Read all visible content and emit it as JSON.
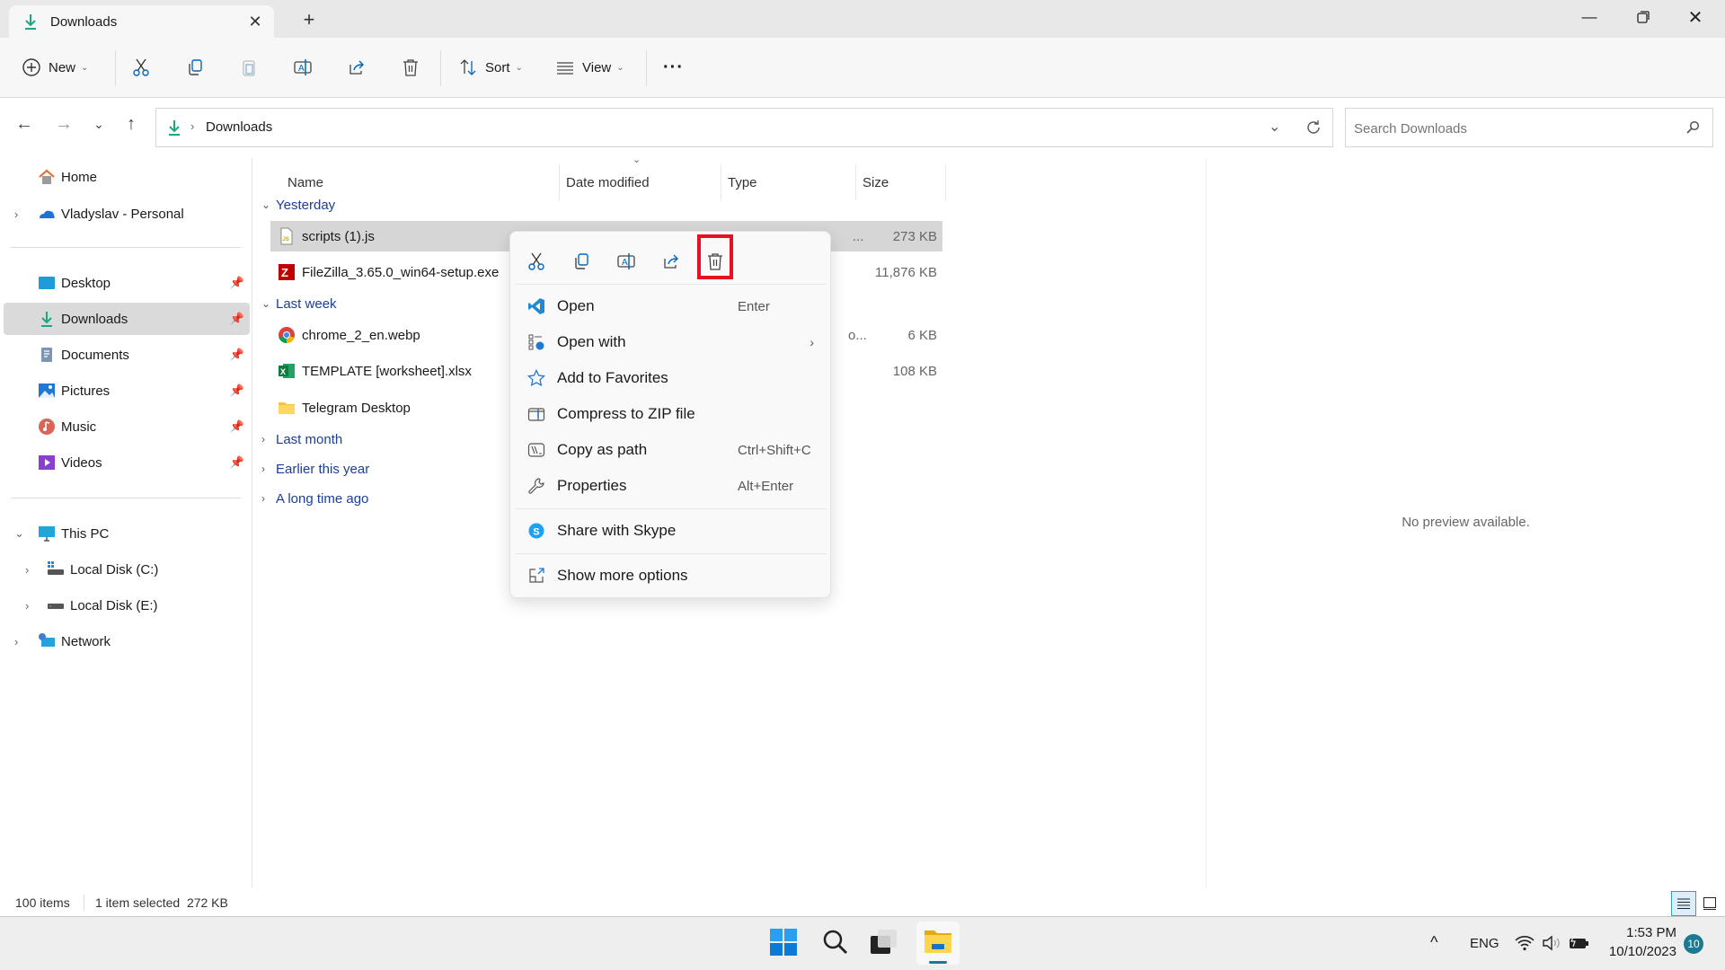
{
  "window": {
    "tab_title": "Downloads",
    "tab_icon": "download-icon",
    "controls": {
      "minimize": "minimize-icon",
      "maximize": "restore-icon",
      "close": "close-icon"
    }
  },
  "toolbar": {
    "new_label": "New",
    "sort_label": "Sort",
    "view_label": "View",
    "buttons": [
      "cut",
      "copy",
      "paste",
      "rename",
      "share",
      "delete"
    ],
    "more": "more-options"
  },
  "address": {
    "path": [
      "Downloads"
    ],
    "search_placeholder": "Search Downloads"
  },
  "sidebar": {
    "top": [
      {
        "label": "Home",
        "icon": "home-icon"
      },
      {
        "label": "Vladyslav - Personal",
        "icon": "onedrive-icon",
        "expandable": true
      }
    ],
    "quick_access": [
      {
        "label": "Desktop",
        "icon": "desktop-icon",
        "pinned": true
      },
      {
        "label": "Downloads",
        "icon": "download-icon",
        "pinned": true,
        "selected": true
      },
      {
        "label": "Documents",
        "icon": "documents-icon",
        "pinned": true
      },
      {
        "label": "Pictures",
        "icon": "pictures-icon",
        "pinned": true
      },
      {
        "label": "Music",
        "icon": "music-icon",
        "pinned": true
      },
      {
        "label": "Videos",
        "icon": "videos-icon",
        "pinned": true
      }
    ],
    "this_pc": {
      "label": "This PC",
      "expanded": true
    },
    "drives": [
      {
        "label": "Local Disk (C:)"
      },
      {
        "label": "Local Disk (E:)"
      }
    ],
    "network": {
      "label": "Network"
    }
  },
  "filelist": {
    "columns": [
      "Name",
      "Date modified",
      "Type",
      "Size"
    ],
    "groups": [
      {
        "label": "Yesterday",
        "expanded": true
      },
      {
        "label": "Last week",
        "expanded": true
      },
      {
        "label": "Last month",
        "expanded": false
      },
      {
        "label": "Earlier this year",
        "expanded": false
      },
      {
        "label": "A long time ago",
        "expanded": false
      }
    ],
    "files": [
      {
        "name": "scripts (1).js",
        "size": "273 KB",
        "type_trunc": "...",
        "selected": true,
        "icon": "js-file-icon"
      },
      {
        "name": "FileZilla_3.65.0_win64-setup.exe",
        "size": "11,876 KB",
        "icon": "filezilla-icon"
      },
      {
        "name": "chrome_2_en.webp",
        "size": "6 KB",
        "type_trunc": "o...",
        "icon": "chrome-icon"
      },
      {
        "name": "TEMPLATE [worksheet].xlsx",
        "size": "108 KB",
        "icon": "excel-icon"
      },
      {
        "name": "Telegram Desktop",
        "size": "",
        "icon": "folder-icon"
      }
    ]
  },
  "context_menu": {
    "quick_actions": [
      "cut",
      "copy",
      "rename",
      "share",
      "delete"
    ],
    "highlighted_action": "delete",
    "items": [
      {
        "label": "Open",
        "shortcut": "Enter",
        "icon": "vscode-icon"
      },
      {
        "label": "Open with",
        "shortcut": "",
        "submenu": true,
        "icon": "open-with-icon"
      },
      {
        "label": "Add to Favorites",
        "shortcut": "",
        "icon": "star-icon"
      },
      {
        "label": "Compress to ZIP file",
        "shortcut": "",
        "icon": "zip-icon"
      },
      {
        "label": "Copy as path",
        "shortcut": "Ctrl+Shift+C",
        "icon": "copy-path-icon"
      },
      {
        "label": "Properties",
        "shortcut": "Alt+Enter",
        "icon": "wrench-icon"
      },
      {
        "label": "Share with Skype",
        "shortcut": "",
        "icon": "skype-icon"
      },
      {
        "label": "Show more options",
        "shortcut": "",
        "icon": "show-more-icon"
      }
    ]
  },
  "preview": {
    "message": "No preview available."
  },
  "status": {
    "items_count": "100 items",
    "selection": "1 item selected  272 KB"
  },
  "taskbar": {
    "apps": [
      "start",
      "search",
      "task-view",
      "file-explorer"
    ],
    "tray": {
      "language": "ENG",
      "time": "1:53 PM",
      "date": "10/10/2023",
      "notifications": "10"
    }
  },
  "colors": {
    "accent": "#0067c0",
    "highlight_box": "#e81123",
    "group_text": "#1b3e9a"
  }
}
